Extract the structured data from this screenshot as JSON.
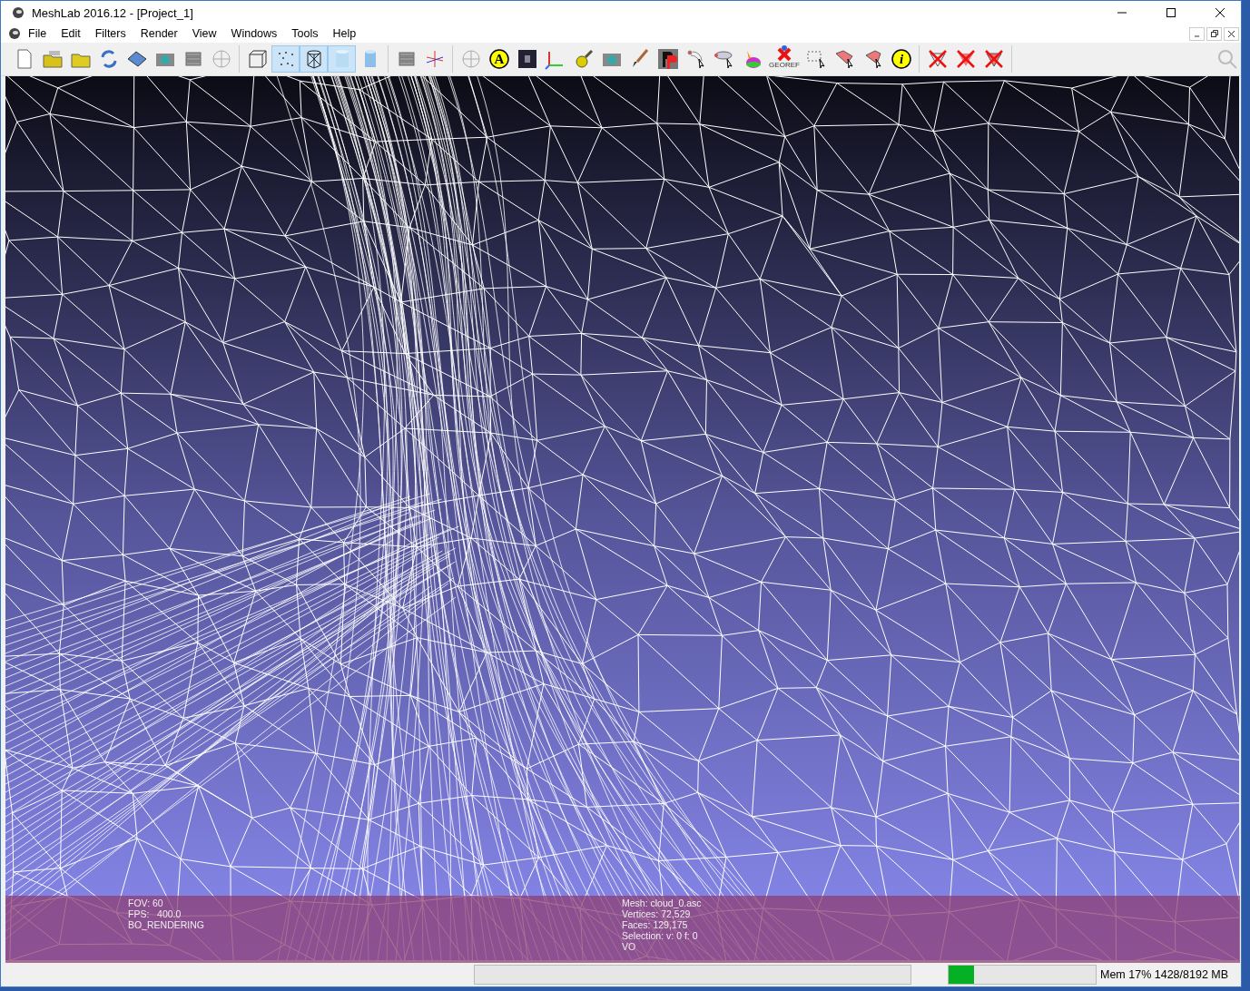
{
  "window": {
    "title": "MeshLab 2016.12 - [Project_1]"
  },
  "menu": [
    "File",
    "Edit",
    "Filters",
    "Render",
    "View",
    "Windows",
    "Tools",
    "Help"
  ],
  "toolbar": {
    "render_modes": [
      {
        "selected": false
      },
      {
        "selected": true
      },
      {
        "selected": true
      },
      {
        "selected": true
      },
      {
        "selected": false
      }
    ],
    "annotation_label": "A",
    "georef_label": "GEOREF",
    "info_label": "i"
  },
  "viewport": {
    "left_info": [
      "FOV: 60",
      "FPS:   400.0",
      "BO_RENDERING"
    ],
    "right_info": [
      "Mesh: cloud_0.asc",
      "Vertices: 72,529",
      "Faces: 129,175",
      "Selection: v: 0 f: 0",
      "VO"
    ]
  },
  "status_bar": {
    "memory": {
      "level": 0.17,
      "reading": "Mem 17% 1428/8192 MB"
    }
  }
}
